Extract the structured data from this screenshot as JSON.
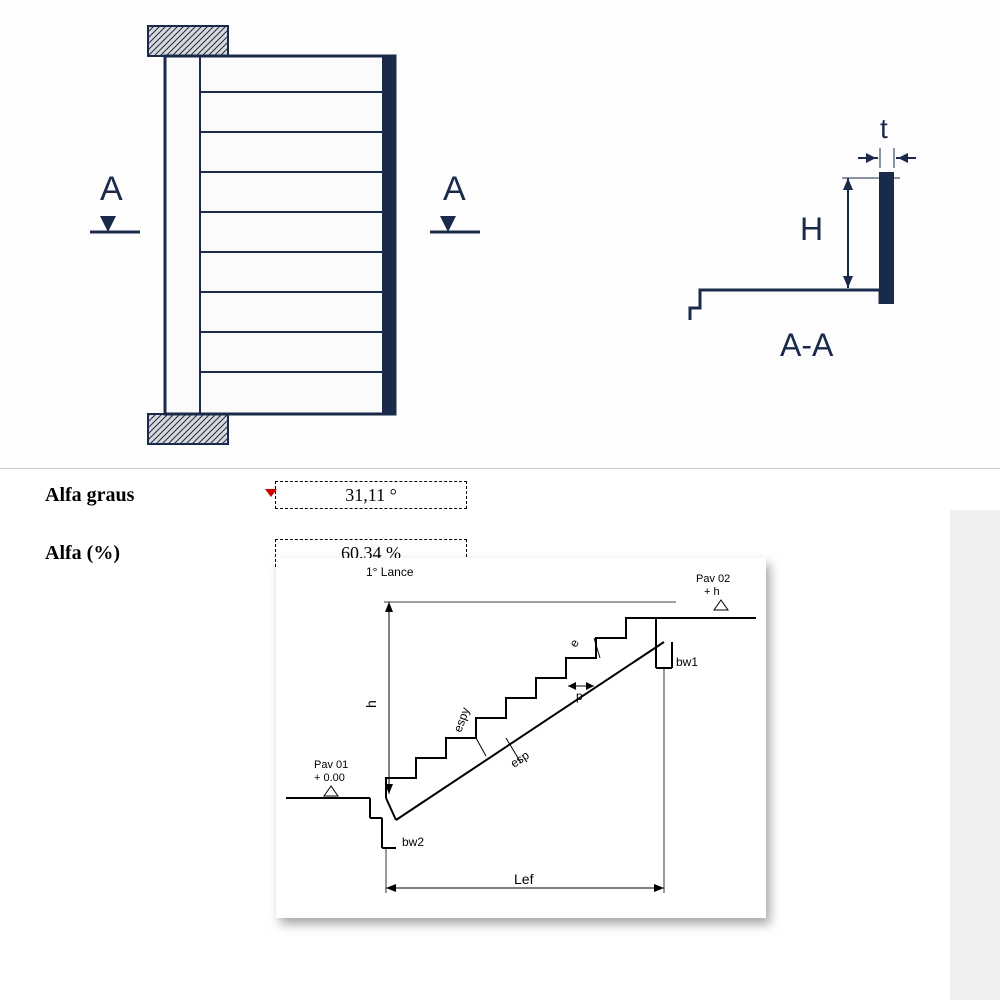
{
  "fields": {
    "alfa_graus": {
      "label": "Alfa graus",
      "value": "31,11 °"
    },
    "alfa_pct": {
      "label": "Alfa (%)",
      "value": "60,34 %"
    }
  },
  "top_diagram": {
    "left_marker": "A",
    "right_marker": "A",
    "section_label": "A-A",
    "dim_t": "t",
    "dim_H": "H"
  },
  "bottom_diagram": {
    "title": "1° Lance",
    "pav01_label": "Pav 01",
    "pav01_level": "+ 0.00",
    "pav02_label": "Pav 02",
    "pav02_level": "+ h",
    "dim_h": "h",
    "dim_e": "e",
    "dim_p": "p",
    "dim_espy": "espy",
    "dim_esp": "esp",
    "dim_bw1": "bw1",
    "dim_bw2": "bw2",
    "dim_lef": "Lef"
  }
}
